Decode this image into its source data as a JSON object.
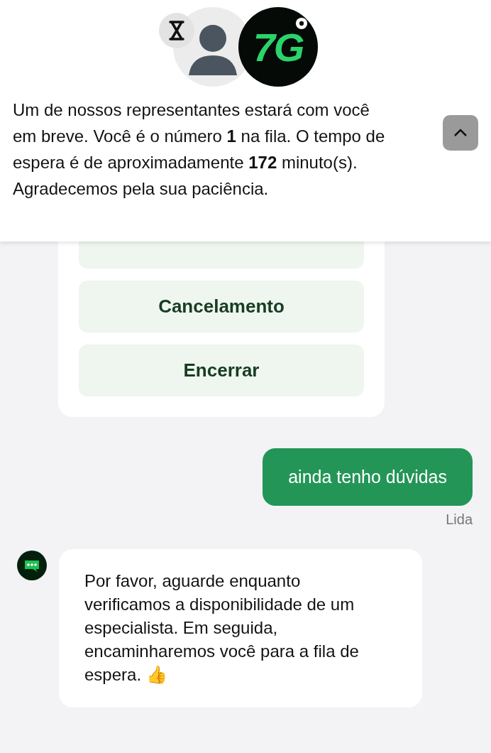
{
  "header": {
    "logo_text": "7G",
    "notice": "Um de nossos representantes estará com você em breve. Você é o número **1** na fila. O tempo de espera é de aproximadamente **172** minuto(s). Agradecemos pela sua paciência."
  },
  "options": [
    "Cancelamento",
    "Encerrar"
  ],
  "messages": [
    {
      "kind": "user",
      "text": "ainda tenho dúvidas",
      "status": "Lida"
    },
    {
      "kind": "bot",
      "text": "Por favor, aguarde enquanto verificamos a disponibilidade de um especialista. Em seguida, encaminharemos você para a fila de espera. 👍"
    }
  ]
}
